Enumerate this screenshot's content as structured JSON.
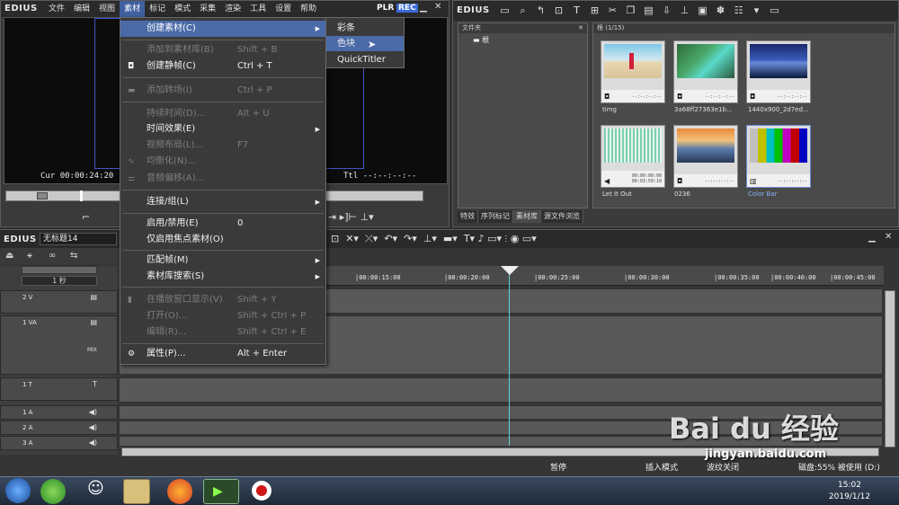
{
  "player": {
    "logo": "EDIUS",
    "menus": [
      "文件",
      "编辑",
      "视图",
      "素材",
      "标记",
      "模式",
      "采集",
      "渲染",
      "工具",
      "设置",
      "帮助"
    ],
    "plr": "PLR",
    "rec": "REC",
    "cur_label": "Cur",
    "cur_value": "00:00:24:20",
    "ttl_label": "Ttl",
    "ttl_value": "--:--:--:--"
  },
  "bin": {
    "logo": "EDIUS",
    "folder_header": "文件夹",
    "root_label": "根",
    "clip_header": "根 (1/15)",
    "clips": [
      {
        "name": "timg",
        "dur": "--:--:--:--"
      },
      {
        "name": "3a68ff27363e1b...",
        "dur": "--:--:--:--"
      },
      {
        "name": "1440x900_2d7ed...",
        "dur": "--:--:--:--"
      },
      {
        "name": "Let It Out",
        "dur1": "00:00:00:00",
        "dur2": "00:03:50:10"
      },
      {
        "name": "0236",
        "dur": "--:--:--:--"
      },
      {
        "name": "Color Bar",
        "dur": "--:--:--:--"
      }
    ],
    "tabs": [
      "特效",
      "序列标记",
      "素材库",
      "源文件浏览"
    ]
  },
  "menu": {
    "items": [
      {
        "label": "创建素材(C)",
        "shortcut": "",
        "state": "hl",
        "arrow": true
      },
      {
        "label": "添加到素材库(B)",
        "shortcut": "Shift + B",
        "state": "dis"
      },
      {
        "label": "创建静帧(C)",
        "shortcut": "Ctrl + T",
        "state": "en"
      },
      {
        "label": "添加转场(I)",
        "shortcut": "Ctrl + P",
        "state": "dis"
      },
      {
        "label": "持续时间(D)...",
        "shortcut": "Alt + U",
        "state": "dis"
      },
      {
        "label": "时间效果(E)",
        "shortcut": "",
        "state": "en",
        "arrow": true
      },
      {
        "label": "视频布局(L)...",
        "shortcut": "F7",
        "state": "dis"
      },
      {
        "label": "均衡化(N)...",
        "shortcut": "",
        "state": "dis"
      },
      {
        "label": "音频偏移(A)...",
        "shortcut": "",
        "state": "dis"
      },
      {
        "label": "连接/组(L)",
        "shortcut": "",
        "state": "en",
        "arrow": true
      },
      {
        "label": "启用/禁用(E)",
        "shortcut": "0",
        "state": "en"
      },
      {
        "label": "仅启用焦点素材(O)",
        "shortcut": "",
        "state": "en"
      },
      {
        "label": "匹配帧(M)",
        "shortcut": "",
        "state": "en",
        "arrow": true
      },
      {
        "label": "素材库搜索(S)",
        "shortcut": "",
        "state": "en",
        "arrow": true
      },
      {
        "label": "在播放窗口显示(V)",
        "shortcut": "Shift + Y",
        "state": "dis"
      },
      {
        "label": "打开(O)...",
        "shortcut": "Shift + Ctrl + P",
        "state": "dis"
      },
      {
        "label": "编辑(R)...",
        "shortcut": "Shift + Ctrl + E",
        "state": "dis"
      },
      {
        "label": "属性(P)...",
        "shortcut": "Alt + Enter",
        "state": "en"
      }
    ],
    "submenu": [
      "彩条",
      "色块",
      "QuickTitler"
    ]
  },
  "timeline": {
    "logo": "EDIUS",
    "sequence_name": "无标题14",
    "zoom": "1 秒",
    "ticks": [
      "|00:00:15:00",
      "|00:00:20:00",
      "|00:00:25:00",
      "|00:00:30:00",
      "|00:00:35:00",
      "|00:00:40:00",
      "|00:00:45:00"
    ],
    "tracks": [
      {
        "name": "2 V"
      },
      {
        "name": "1 VA",
        "mix": "MIX"
      },
      {
        "name": "1 T",
        "ic": "T"
      },
      {
        "name": "1 A"
      },
      {
        "name": "2 A"
      },
      {
        "name": "3 A"
      }
    ]
  },
  "status": {
    "pause": "暂停",
    "insert_mode": "插入模式",
    "ripple_off": "波纹关闭",
    "disk": "磁盘:55% 被使用 (D:)"
  },
  "taskbar": {
    "time": "15:02",
    "date": "2019/1/12"
  },
  "watermark": {
    "brand": "Bai du 经验",
    "url": "jingyan.baidu.com"
  }
}
